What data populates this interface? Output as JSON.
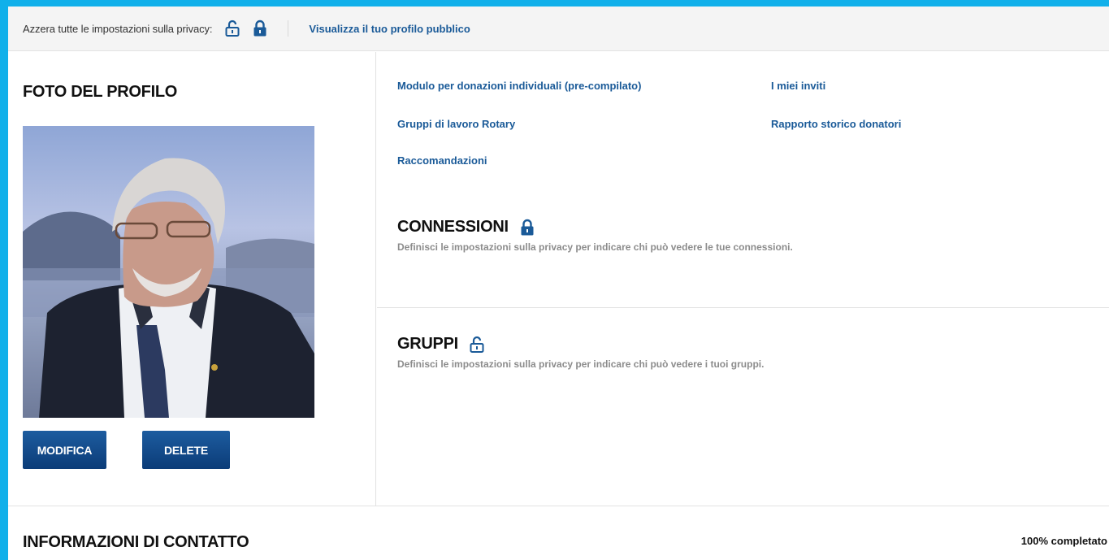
{
  "privacy_bar": {
    "label": "Azzera tutte le impostazioni sulla privacy:",
    "open_lock_icon": "lock-open-icon",
    "closed_lock_icon": "lock-closed-icon",
    "public_profile_link": "Visualizza il tuo profilo pubblico"
  },
  "photo_section": {
    "title": "FOTO DEL PROFILO",
    "edit_label": "MODIFICA",
    "delete_label": "DELETE"
  },
  "links": [
    "Modulo per donazioni individuali (pre-compilato)",
    "I miei inviti",
    "Gruppi di lavoro Rotary",
    "Rapporto storico donatori",
    "Raccomandazioni"
  ],
  "connections": {
    "title": "CONNESSIONI",
    "lock_icon": "lock-closed-icon",
    "description": "Definisci le impostazioni sulla privacy per indicare chi può vedere le tue connessioni."
  },
  "groups": {
    "title": "GRUPPI",
    "lock_icon": "lock-open-icon",
    "description": "Definisci le impostazioni sulla privacy per indicare chi può vedere i tuoi gruppi."
  },
  "contact": {
    "title": "INFORMAZIONI DI CONTATTO",
    "completion": "100% completato"
  },
  "colors": {
    "page_border": "#11b0ea",
    "link": "#1a5a98",
    "button": "#0b3c78"
  }
}
